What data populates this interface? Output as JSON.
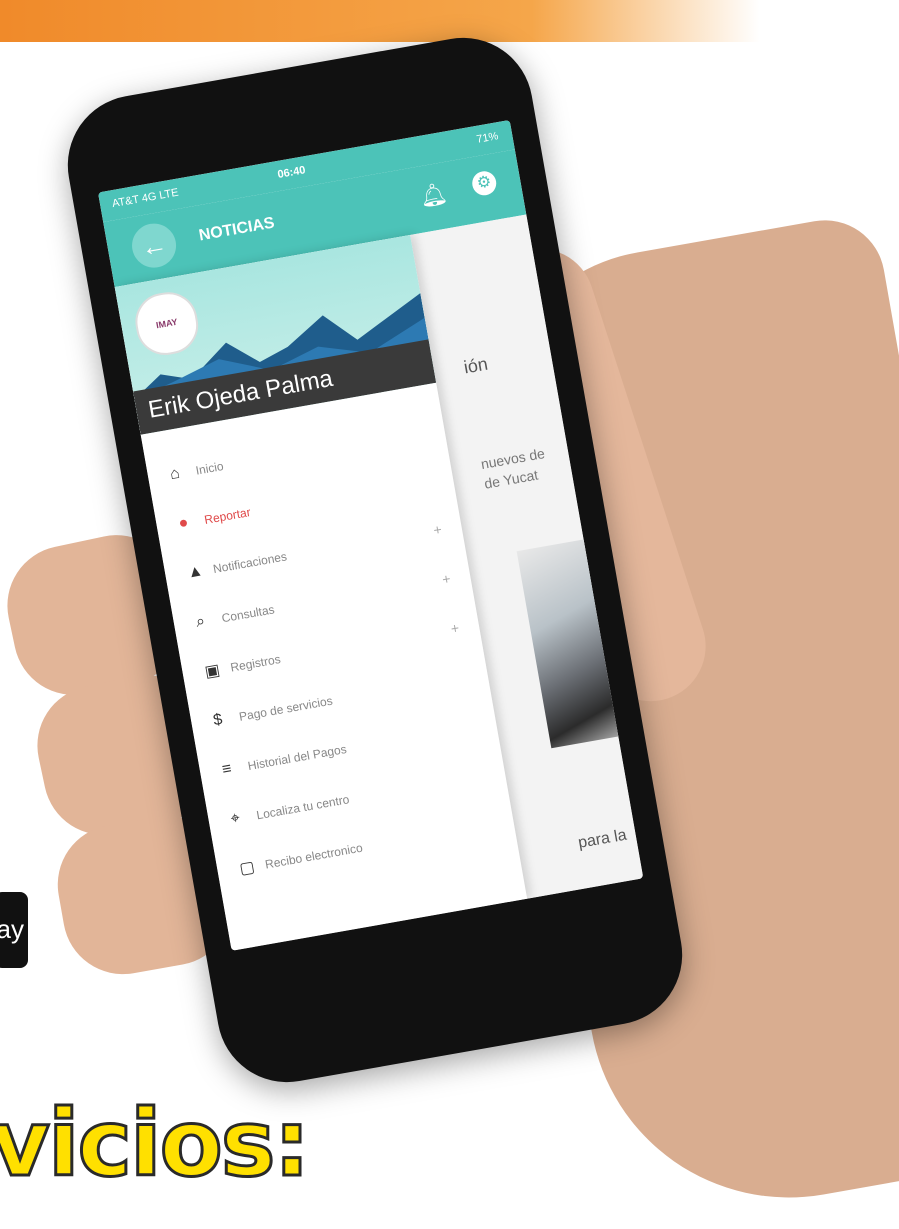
{
  "status_bar": {
    "carrier": "AT&T 4G LTE",
    "time": "06:40",
    "battery": "71%"
  },
  "app_bar": {
    "title": "NOTICIAS"
  },
  "drawer": {
    "logo_text": "IMAY",
    "user_name": "Erik Ojeda Palma",
    "items": [
      {
        "label": "Inicio",
        "icon": "home-icon",
        "glyph": "⌂",
        "active": false,
        "expandable": false
      },
      {
        "label": "Reportar",
        "icon": "alert-icon",
        "glyph": "●",
        "active": true,
        "expandable": false
      },
      {
        "label": "Notificaciones",
        "icon": "bell-icon",
        "glyph": "▲",
        "active": false,
        "expandable": true
      },
      {
        "label": "Consultas",
        "icon": "search-icon",
        "glyph": "⌕",
        "active": false,
        "expandable": true
      },
      {
        "label": "Registros",
        "icon": "register-icon",
        "glyph": "▣",
        "active": false,
        "expandable": true
      },
      {
        "label": "Pago de servicios",
        "icon": "dollar-icon",
        "glyph": "$",
        "active": false,
        "expandable": false
      },
      {
        "label": "Historial del Pagos",
        "icon": "list-icon",
        "glyph": "≡",
        "active": false,
        "expandable": false
      },
      {
        "label": "Localiza tu centro",
        "icon": "map-icon",
        "glyph": "⌖",
        "active": false,
        "expandable": false
      },
      {
        "label": "Recibo electronico",
        "icon": "receipt-icon",
        "glyph": "▢",
        "active": false,
        "expandable": false
      }
    ]
  },
  "background_content": {
    "heading_fragment": "ión",
    "line1": "nuevos de",
    "line2": "de Yucat",
    "footer_fragment": "para la"
  },
  "page": {
    "bottom_title": "vicios:",
    "badge_text": "ay"
  },
  "colors": {
    "primary": "#4cc3b8",
    "accent_red": "#e04a4a",
    "banner": "#f08a2a",
    "title_yellow": "#ffe000"
  }
}
